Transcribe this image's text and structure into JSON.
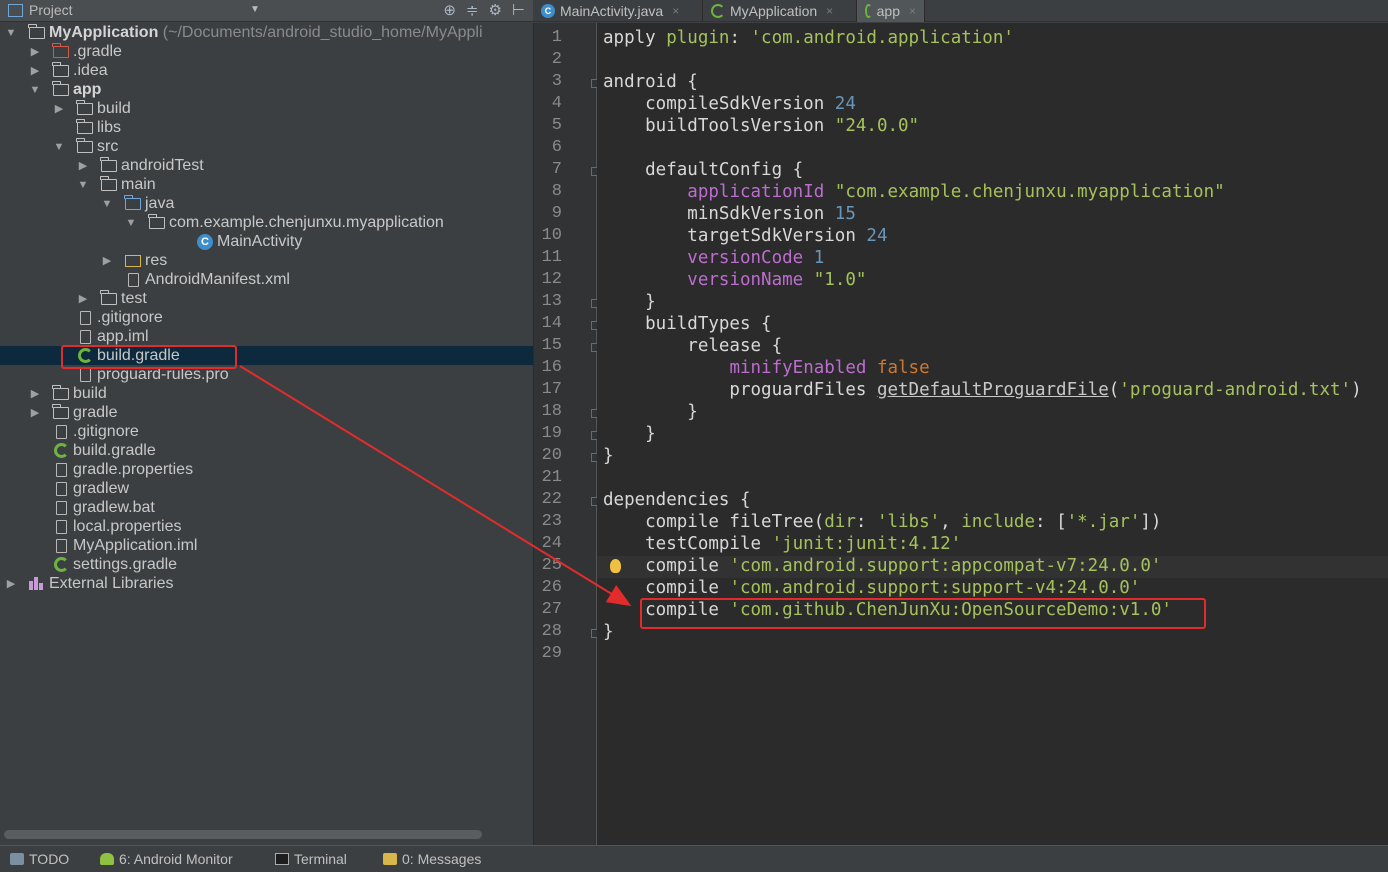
{
  "project_pane": {
    "title": "Project",
    "tree": [
      {
        "label": "MyApplication",
        "hint": "(~/Documents/android_studio_home/MyAppli",
        "depth": 0,
        "arrow": "▼",
        "icon": "module-folder-icon",
        "bold": true
      },
      {
        "label": ".gradle",
        "depth": 1,
        "arrow": "▶",
        "icon": "red-folder-icon"
      },
      {
        "label": ".idea",
        "depth": 1,
        "arrow": "▶",
        "icon": "folder-icon"
      },
      {
        "label": "app",
        "depth": 1,
        "arrow": "▼",
        "icon": "module-folder-icon",
        "bold": true
      },
      {
        "label": "build",
        "depth": 2,
        "arrow": "▶",
        "icon": "folder-icon"
      },
      {
        "label": "libs",
        "depth": 2,
        "arrow": "",
        "icon": "folder-icon"
      },
      {
        "label": "src",
        "depth": 2,
        "arrow": "▼",
        "icon": "folder-icon"
      },
      {
        "label": "androidTest",
        "depth": 3,
        "arrow": "▶",
        "icon": "folder-icon"
      },
      {
        "label": "main",
        "depth": 3,
        "arrow": "▼",
        "icon": "folder-icon"
      },
      {
        "label": "java",
        "depth": 4,
        "arrow": "▼",
        "icon": "blue-folder-icon"
      },
      {
        "label": "com.example.chenjunxu.myapplication",
        "depth": 5,
        "arrow": "▼",
        "icon": "package-icon"
      },
      {
        "label": "MainActivity",
        "depth": 7,
        "arrow": "",
        "icon": "class-icon"
      },
      {
        "label": "res",
        "depth": 4,
        "arrow": "▶",
        "icon": "res-folder-icon"
      },
      {
        "label": "AndroidManifest.xml",
        "depth": 4,
        "arrow": "",
        "icon": "xml-file-icon"
      },
      {
        "label": "test",
        "depth": 3,
        "arrow": "▶",
        "icon": "folder-icon"
      },
      {
        "label": ".gitignore",
        "depth": 2,
        "arrow": "",
        "icon": "file-icon"
      },
      {
        "label": "app.iml",
        "depth": 2,
        "arrow": "",
        "icon": "iml-file-icon"
      },
      {
        "label": "build.gradle",
        "depth": 2,
        "arrow": "",
        "icon": "gradle-icon",
        "selected": true
      },
      {
        "label": "proguard-rules.pro",
        "depth": 2,
        "arrow": "",
        "icon": "file-icon"
      },
      {
        "label": "build",
        "depth": 1,
        "arrow": "▶",
        "icon": "folder-icon"
      },
      {
        "label": "gradle",
        "depth": 1,
        "arrow": "▶",
        "icon": "folder-icon"
      },
      {
        "label": ".gitignore",
        "depth": 1,
        "arrow": "",
        "icon": "file-icon"
      },
      {
        "label": "build.gradle",
        "depth": 1,
        "arrow": "",
        "icon": "gradle-icon"
      },
      {
        "label": "gradle.properties",
        "depth": 1,
        "arrow": "",
        "icon": "properties-file-icon"
      },
      {
        "label": "gradlew",
        "depth": 1,
        "arrow": "",
        "icon": "file-icon"
      },
      {
        "label": "gradlew.bat",
        "depth": 1,
        "arrow": "",
        "icon": "file-icon"
      },
      {
        "label": "local.properties",
        "depth": 1,
        "arrow": "",
        "icon": "properties-file-icon"
      },
      {
        "label": "MyApplication.iml",
        "depth": 1,
        "arrow": "",
        "icon": "iml-file-icon"
      },
      {
        "label": "settings.gradle",
        "depth": 1,
        "arrow": "",
        "icon": "gradle-icon"
      },
      {
        "label": "External Libraries",
        "depth": 0,
        "arrow": "▶",
        "icon": "libraries-icon"
      }
    ]
  },
  "tabs": [
    {
      "label": "MainActivity.java",
      "icon": "class-icon",
      "active": false
    },
    {
      "label": "MyApplication",
      "icon": "gradle-icon",
      "active": false
    },
    {
      "label": "app",
      "icon": "gradle-icon",
      "active": true
    }
  ],
  "editor": {
    "lines": [
      "apply plugin: 'com.android.application'",
      "",
      "android {",
      "    compileSdkVersion 24",
      "    buildToolsVersion \"24.0.0\"",
      "",
      "    defaultConfig {",
      "        applicationId \"com.example.chenjunxu.myapplication\"",
      "        minSdkVersion 15",
      "        targetSdkVersion 24",
      "        versionCode 1",
      "        versionName \"1.0\"",
      "    }",
      "    buildTypes {",
      "        release {",
      "            minifyEnabled false",
      "            proguardFiles getDefaultProguardFile('proguard-android.txt')",
      "        }",
      "    }",
      "}",
      "",
      "dependencies {",
      "    compile fileTree(dir: 'libs', include: ['*.jar'])",
      "    testCompile 'junit:junit:4.12'",
      "    compile 'com.android.support:appcompat-v7:24.0.0'",
      "    compile 'com.android.support:support-v4:24.0.0'",
      "    compile 'com.github.ChenJunXu:OpenSourceDemo:v1.0'",
      "}",
      ""
    ],
    "line_numbers": [
      "1",
      "2",
      "3",
      "4",
      "5",
      "6",
      "7",
      "8",
      "9",
      "10",
      "11",
      "12",
      "13",
      "14",
      "15",
      "16",
      "17",
      "18",
      "19",
      "20",
      "21",
      "22",
      "23",
      "24",
      "25",
      "26",
      "27",
      "28",
      "29"
    ],
    "colors": {
      "keyword": "#cc7832",
      "string": "#a5c25c",
      "number": "#6897bb",
      "property": "#bd6dd0"
    }
  },
  "bottom_bar": {
    "items": [
      {
        "label": "TODO",
        "icon": "todo-icon"
      },
      {
        "label": "6: Android Monitor",
        "icon": "android-icon"
      },
      {
        "label": "Terminal",
        "icon": "terminal-icon"
      },
      {
        "label": "0: Messages",
        "icon": "messages-icon"
      }
    ]
  },
  "annotation": {
    "color": "#e22c2c"
  }
}
